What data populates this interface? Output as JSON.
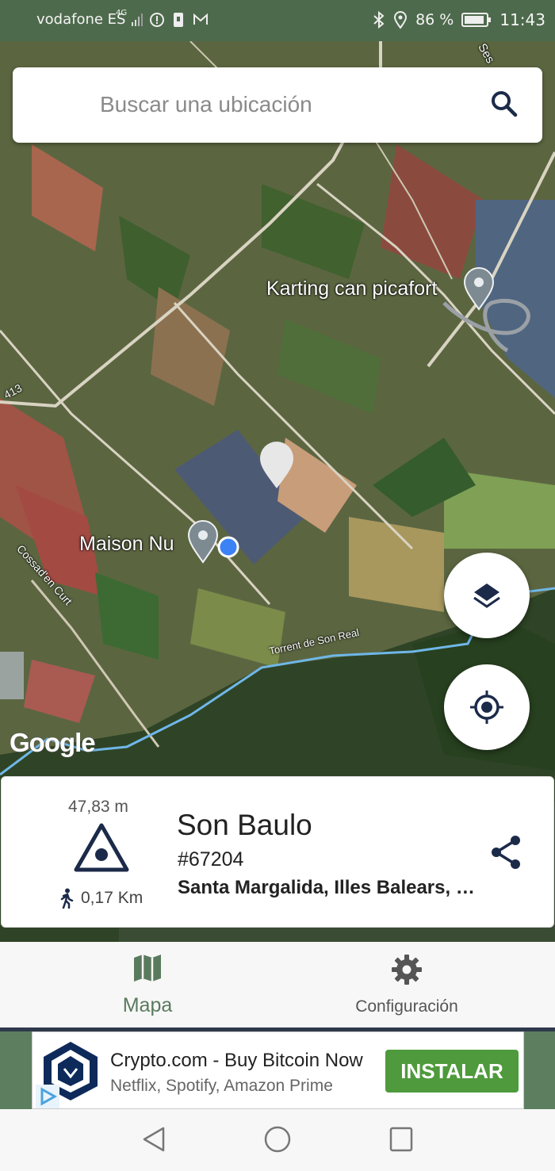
{
  "status_bar": {
    "carrier": "vodafone ES",
    "network_badge": "4G",
    "battery_percent": "86 %",
    "time": "11:43",
    "icons": [
      "signal-icon",
      "alert-icon",
      "sim-icon",
      "mail-icon",
      "bluetooth-icon",
      "location-icon",
      "battery-icon"
    ]
  },
  "search": {
    "placeholder": "Buscar una ubicación"
  },
  "map": {
    "labels": {
      "karting": "Karting can picafort",
      "maison": "Maison Nu",
      "torrent": "Torrent de Son Real",
      "road_413": "413",
      "road_cossad": "Cossad'en Curt",
      "road_ses": "Ses"
    },
    "attribution": "Google",
    "controls": [
      "layers-button",
      "my-location-button"
    ],
    "colors": {
      "pin_gray": "#7d8a92",
      "pin_selected": "#e7e7e7",
      "user_dot": "#3b82f6",
      "river": "#6fb7e8"
    }
  },
  "info_card": {
    "elevation": "47,83 m",
    "walk_distance": "0,17 Km",
    "name": "Son Baulo",
    "id": "#67204",
    "place": "Santa Margalida, Illes Balears, España"
  },
  "bottom_nav": {
    "items": [
      {
        "label": "Mapa",
        "icon": "map-icon",
        "active": true
      },
      {
        "label": "Configuración",
        "icon": "gear-icon",
        "active": false
      }
    ],
    "active_color": "#5a7a5e",
    "inactive_color": "#555555"
  },
  "ad": {
    "title": "Crypto.com - Buy Bitcoin Now",
    "subtitle": "Netflix, Spotify, Amazon Prime",
    "cta": "INSTALAR",
    "cta_color": "#4e9a3c"
  },
  "system_nav": {
    "buttons": [
      "back-icon",
      "home-icon",
      "recents-icon"
    ]
  }
}
